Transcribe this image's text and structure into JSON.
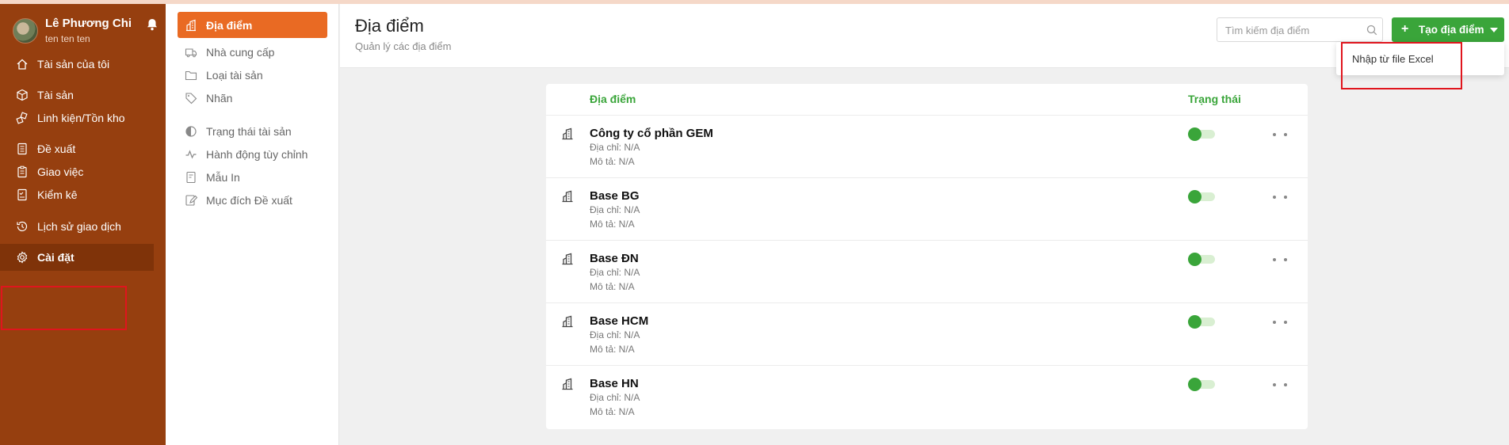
{
  "user": {
    "name": "Lê Phương Chi",
    "subtitle": "ten ten ten"
  },
  "left_nav": {
    "items": [
      {
        "label": "Tài sản của tôi",
        "icon": "home-icon"
      },
      {
        "label": "Tài sản",
        "icon": "box-icon"
      },
      {
        "label": "Linh kiện/Tồn kho",
        "icon": "components-icon"
      },
      {
        "label": "Đề xuất",
        "icon": "document-icon"
      },
      {
        "label": "Giao việc",
        "icon": "clipboard-icon"
      },
      {
        "label": "Kiểm kê",
        "icon": "checklist-icon"
      },
      {
        "label": "Lịch sử giao dịch",
        "icon": "history-icon"
      },
      {
        "label": "Cài đặt",
        "icon": "gear-icon",
        "active": true
      }
    ]
  },
  "settings_nav": {
    "items": [
      {
        "label": "Địa điểm",
        "icon": "building-icon",
        "active": true
      },
      {
        "label": "Nhà cung cấp",
        "icon": "truck-icon"
      },
      {
        "label": "Loại tài sản",
        "icon": "folder-icon"
      },
      {
        "label": "Nhãn",
        "icon": "tag-icon"
      },
      {
        "label": "Trạng thái tài sản",
        "icon": "half-circle-icon"
      },
      {
        "label": "Hành động tùy chỉnh",
        "icon": "activity-icon"
      },
      {
        "label": "Mẫu In",
        "icon": "print-template-icon"
      },
      {
        "label": "Mục đích Đề xuất",
        "icon": "edit-icon"
      }
    ]
  },
  "header": {
    "title": "Địa điểm",
    "subtitle": "Quản lý các địa điểm",
    "search_placeholder": "Tìm kiếm địa điểm",
    "create_button": "Tạo địa điểm",
    "dropdown_item": "Nhập từ file Excel"
  },
  "table": {
    "columns": [
      "Địa điểm",
      "Trạng thái"
    ],
    "rows": [
      {
        "name": "Công ty cổ phần GEM",
        "address": "Địa chỉ: N/A",
        "description": "Mô tả: N/A",
        "active": true
      },
      {
        "name": "Base BG",
        "address": "Địa chỉ: N/A",
        "description": "Mô tả: N/A",
        "active": true
      },
      {
        "name": "Base ĐN",
        "address": "Địa chỉ: N/A",
        "description": "Mô tả: N/A",
        "active": true
      },
      {
        "name": "Base HCM",
        "address": "Địa chỉ: N/A",
        "description": "Mô tả: N/A",
        "active": true
      },
      {
        "name": "Base HN",
        "address": "Địa chỉ: N/A",
        "description": "Mô tả: N/A",
        "active": true
      }
    ]
  },
  "colors": {
    "nav_bg": "#963f0f",
    "accent": "#e96a23",
    "green": "#3aa53a",
    "highlight": "#e0151d"
  }
}
